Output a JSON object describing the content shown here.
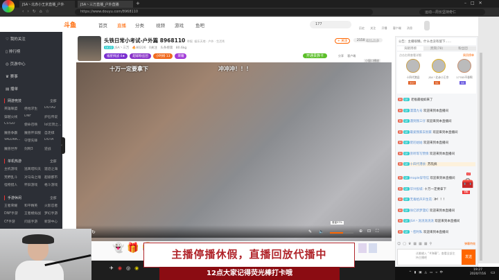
{
  "browser": {
    "tabs": [
      "JSA丶北赤小王京直播_户外",
      " JSA丶三万直播_户外直播"
    ],
    "url": "https://www.douyu.com/8968110",
    "search_placeholder": "运动—周长坚持奇仁"
  },
  "nav": {
    "logo": "斗鱼",
    "items": [
      "首页",
      "直播",
      "分类",
      "视频",
      "游戏",
      "鱼吧"
    ],
    "search_value": "177",
    "icons": [
      "历史",
      "关注",
      "开播",
      "客户端",
      "消息"
    ]
  },
  "sidebar": {
    "top_items": [
      "我的关注",
      "排行榜",
      "页游中心",
      "赛事",
      "播单"
    ],
    "sections": [
      {
        "title": "网游竞技",
        "more": "全部",
        "items": [
          "英雄联盟",
          "绝地求生",
          "DOTA2",
          "穿越火线",
          "DNF",
          "炉石传说",
          "CS:GO",
          "使命召唤",
          "lol云顶之...",
          "魔兽争霸",
          "魔兽怀旧服",
          "自走棋",
          "VALORA...",
          "守望先锋",
          "DOTA",
          "魔兽世界",
          "剑网3",
          "逆战"
        ]
      },
      {
        "title": "单机热游",
        "more": "全部",
        "items": [
          "主机游戏",
          "逃离塔科夫",
          "遗迹之海",
          "荒野乱斗",
          "对马岛之魂",
          "超级都市",
          "怪物猎人",
          "怀旧游戏",
          "格斗游戏"
        ]
      },
      {
        "title": "手游休闲",
        "more": "全部",
        "items": [
          "王者荣耀",
          "和平精英",
          "火影忍者",
          "DNF手游",
          "王者模拟战",
          "梦幻手游",
          "CF手游",
          "问道手游",
          "新游中心"
        ]
      }
    ]
  },
  "streamer": {
    "title": "头铁日常小考试-户外篇",
    "room_id": "8968110",
    "report": "举报",
    "breadcrumb": "娱乐天地 · 户外 · 生活秀",
    "level": "LV.22",
    "name": "JSA丶三万",
    "hot": "80226",
    "followers": "0关注",
    "rank": "头条榜第",
    "weight": "80.6kg",
    "tags": [
      "福星挑战 4★",
      "超级粉丝团",
      "小时榜 13",
      "荣耀"
    ],
    "follow_btn": "+ 关注",
    "follow_count": "2150",
    "followed_label": "已关注",
    "green_btn": "开通贵族卡",
    "share": "分享",
    "client": "客户端",
    "mini": "小窗口播放"
  },
  "video": {
    "caption_left": "十万一定要拿下",
    "caption_right": "冲冲冲！！！",
    "volume_tip": "音量57%",
    "volume": 0.57
  },
  "chat": {
    "notice": "公告：主播很懒，什么也没有留下......",
    "tabs": [
      "贡献周榜",
      "贵宾(78)",
      "粉丝团"
    ],
    "hint": "点击右侧查看详细",
    "weekly_link": "周贡榜单",
    "top3": [
      {
        "name": "十四代港县",
        "lvl": "357"
      },
      {
        "name": "JSA丶北赤小王京",
        "lvl": "51"
      },
      {
        "name": "17783不香啊",
        "lvl": "58"
      }
    ],
    "messages": [
      {
        "user": "",
        "text": "老板最福如来了"
      },
      {
        "user": "漫漫九号",
        "text": "欢迎来到本直播间"
      },
      {
        "user": "遇到我三仔",
        "text": "欢迎来到本直播间"
      },
      {
        "user": "最爱我家去别家",
        "text": "欢迎来到本直播间"
      },
      {
        "user": "佬尼姑姑",
        "text": "欢迎来到本直播间"
      },
      {
        "user": "旁听等写赞情",
        "text": "欢迎来到本直播间"
      },
      {
        "user": "十四代港县:",
        "text": "苏先搞"
      },
      {
        "user": "maple穿穹信",
        "text": "欢迎来到本直播间"
      },
      {
        "user": "华兴投城:",
        "text": "十万一定要拿下"
      },
      {
        "user": "无毒给声声生花:",
        "text": "冲！！！"
      },
      {
        "user": "徐亿新梦漫幻",
        "text": "欢迎来到本直播间"
      },
      {
        "user": "JSA丶洮洮洮洮洮",
        "text": "欢迎来到本直播间"
      },
      {
        "user": "丶密利私",
        "text": "欢迎来到本直播间"
      }
    ],
    "input_placeholder": "试着输入 “#弹幕”，查看全部主持主播吧",
    "send": "发送",
    "treasure_count": "x2",
    "treasure_label": "领取",
    "barrage_label": "弹幕特效"
  },
  "overlay": {
    "banner": "主播停播休假，直播回放代播中",
    "subtitle": "12点大家记得荧光棒打卡哦"
  },
  "taskbar": {
    "time": "19:27",
    "date": "2020/7/16",
    "ime": "中"
  }
}
